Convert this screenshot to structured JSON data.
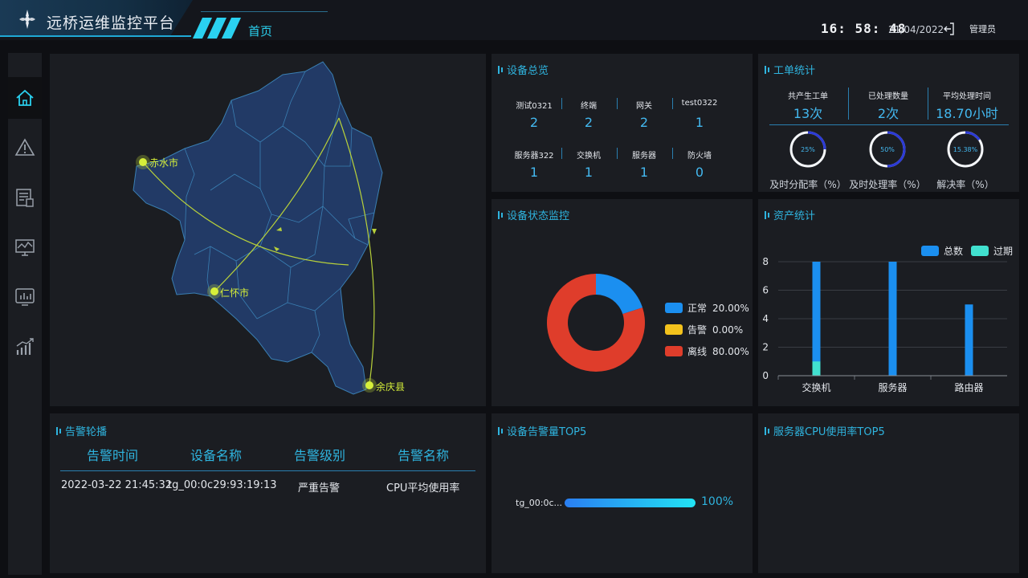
{
  "header": {
    "app_title": "远桥运维监控平台",
    "nav_home": "首页",
    "clock": "16: 58: 48",
    "date": "21/04/2022",
    "user": "管理员"
  },
  "sidebar": {
    "items": [
      {
        "icon": "home-icon"
      },
      {
        "icon": "warning-icon"
      },
      {
        "icon": "device-list-icon"
      },
      {
        "icon": "monitor-chart-icon"
      },
      {
        "icon": "screen-chart-icon"
      },
      {
        "icon": "bar-trend-icon"
      }
    ]
  },
  "map": {
    "cities": [
      "赤水市",
      "仁怀市",
      "余庆县"
    ]
  },
  "overview": {
    "title": "设备总览",
    "items": [
      {
        "label": "测试0321",
        "value": "2"
      },
      {
        "label": "终端",
        "value": "2"
      },
      {
        "label": "网关",
        "value": "2"
      },
      {
        "label": "test0322",
        "value": "1"
      },
      {
        "label": "服务器322",
        "value": "1"
      },
      {
        "label": "交换机",
        "value": "1"
      },
      {
        "label": "服务器",
        "value": "1"
      },
      {
        "label": "防火墙",
        "value": "0"
      }
    ]
  },
  "tickets": {
    "title": "工单统计",
    "stats": [
      {
        "label": "共产生工单",
        "value": "13次"
      },
      {
        "label": "已处理数量",
        "value": "2次"
      },
      {
        "label": "平均处理时间",
        "value": "18.70小时"
      }
    ],
    "rings": [
      {
        "text": "25%",
        "fraction": 0.25,
        "caption": "及时分配率（%）"
      },
      {
        "text": "50%",
        "fraction": 0.5,
        "caption": "及时处理率（%）"
      },
      {
        "text": "15.38%",
        "fraction": 0.1538,
        "caption": "解决率（%）"
      }
    ]
  },
  "status": {
    "title": "设备状态监控",
    "legend": [
      {
        "name": "正常",
        "pct": "20.00%",
        "color": "#1b8ff0"
      },
      {
        "name": "告警",
        "pct": "0.00%",
        "color": "#f3c21c"
      },
      {
        "name": "离线",
        "pct": "80.00%",
        "color": "#df3d2b"
      }
    ]
  },
  "assets": {
    "title": "资产统计",
    "legend": [
      {
        "name": "总数",
        "color": "#1b8ff0"
      },
      {
        "name": "过期",
        "color": "#41e0cf"
      }
    ]
  },
  "alarm": {
    "title": "告警轮播",
    "headers": [
      "告警时间",
      "设备名称",
      "告警级别",
      "告警名称"
    ],
    "rows": [
      {
        "time": "2022-03-22 21:45:32",
        "device": "tg_00:0c29:93:19:13",
        "level": "严重告警",
        "name": "CPU平均使用率"
      }
    ]
  },
  "alarm_top": {
    "title": "设备告警量TOP5",
    "bar_label": "tg_00:0c...",
    "bar_value": "100%",
    "fraction": 1.0
  },
  "cpu_top": {
    "title": "服务器CPU使用率TOP5"
  },
  "chart_data": [
    {
      "type": "pie",
      "title": "设备状态监控",
      "categories": [
        "正常",
        "告警",
        "离线"
      ],
      "values": [
        20,
        0,
        80
      ],
      "colors": [
        "#1b8ff0",
        "#f3c21c",
        "#df3d2b"
      ],
      "legend": "right"
    },
    {
      "type": "bar",
      "title": "资产统计",
      "categories": [
        "交换机",
        "服务器",
        "路由器"
      ],
      "series": [
        {
          "name": "总数",
          "values": [
            8,
            8,
            5
          ],
          "color": "#1b8ff0"
        },
        {
          "name": "过期",
          "values": [
            1,
            0,
            0
          ],
          "color": "#41e0cf"
        }
      ],
      "yticks": [
        0,
        2,
        4,
        6,
        8
      ],
      "ylim": [
        0,
        8
      ],
      "grid": true,
      "legend": "top-right"
    }
  ]
}
